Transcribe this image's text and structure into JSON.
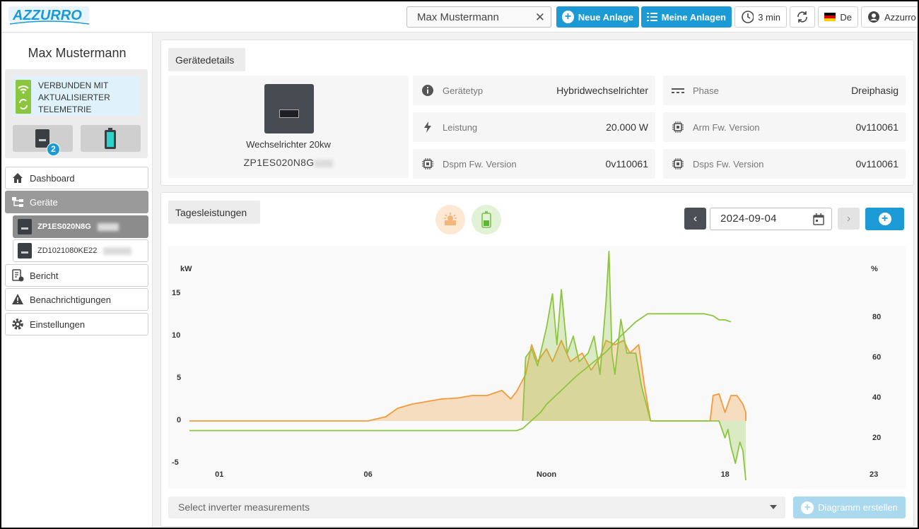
{
  "header": {
    "logo_text": "AZZURRO",
    "search_value": "Max Mustermann",
    "new_plant_label": "Neue Anlage",
    "my_plants_label": "Meine Anlagen",
    "refresh_interval": "3 min",
    "language": "De",
    "account": "Azzurro"
  },
  "sidebar": {
    "user_name": "Max Mustermann",
    "connection_status": "VERBUNDEN MIT AKTUALISIERTER TELEMETRIE",
    "device_count": "2",
    "nav": {
      "dashboard": "Dashboard",
      "devices": "Geräte",
      "device1": "ZP1ES020N8G",
      "device2": "ZD1021080KE22",
      "report": "Bericht",
      "notifications": "Benachrichtigungen",
      "settings": "Einstellungen"
    }
  },
  "device_details": {
    "title": "Gerätedetails",
    "device_name": "Wechselrichter 20kw",
    "serial": "ZP1ES020N8G",
    "specs": [
      {
        "label": "Gerätetyp",
        "value": "Hybridwechselrichter",
        "icon": "info-icon"
      },
      {
        "label": "Phase",
        "value": "Dreiphasig",
        "icon": "phase-icon"
      },
      {
        "label": "Leistung",
        "value": "20.000 W",
        "icon": "bolt-icon"
      },
      {
        "label": "Arm Fw. Version",
        "value": "0v110061",
        "icon": "chip-icon"
      },
      {
        "label": "Dspm Fw. Version",
        "value": "0v110061",
        "icon": "chip-icon"
      },
      {
        "label": "Dsps Fw. Version",
        "value": "0v110061",
        "icon": "chip-icon"
      }
    ]
  },
  "daily": {
    "title": "Tagesleistungen",
    "date": "2024-09-04",
    "select_placeholder": "Select inverter measurements",
    "create_label": "Diagramm erstellen"
  },
  "colors": {
    "accent": "#1b9ad6",
    "pv": "#f39a3c",
    "battery": "#8cc63f"
  },
  "chart_data": {
    "type": "area",
    "y_left_unit": "kW",
    "y_right_unit": "%",
    "y_left_ticks": [
      "15",
      "10",
      "5",
      "0",
      "-5"
    ],
    "y_right_ticks": [
      "80",
      "60",
      "40",
      "20"
    ],
    "x_ticks": [
      "01",
      "06",
      "Noon",
      "18",
      "23"
    ],
    "ylim_left": [
      -7,
      19
    ],
    "ylim_right": [
      20,
      80
    ],
    "series": [
      {
        "color": "#f39a3c",
        "axis": "left",
        "points": [
          [
            0,
            0
          ],
          [
            6,
            0
          ],
          [
            6.6,
            0.5
          ],
          [
            7,
            1.5
          ],
          [
            7.5,
            2
          ],
          [
            8,
            2.3
          ],
          [
            8.5,
            2.6
          ],
          [
            9,
            2.7
          ],
          [
            9.5,
            3
          ],
          [
            10,
            3
          ],
          [
            10.5,
            3.6
          ],
          [
            10.8,
            2.6
          ],
          [
            11,
            3.5
          ],
          [
            11.3,
            5.5
          ],
          [
            11.5,
            9
          ],
          [
            11.7,
            7
          ],
          [
            12,
            8.5
          ],
          [
            12.2,
            7
          ],
          [
            12.5,
            9.5
          ],
          [
            12.8,
            7
          ],
          [
            13.2,
            8
          ],
          [
            13.5,
            6
          ],
          [
            13.8,
            7.5
          ],
          [
            14,
            9.5
          ],
          [
            14.3,
            9
          ],
          [
            14.6,
            9.5
          ],
          [
            14.8,
            8
          ],
          [
            15.1,
            9
          ],
          [
            15.3,
            4
          ],
          [
            15.5,
            0
          ],
          [
            17.5,
            0
          ],
          [
            17.6,
            3
          ],
          [
            17.8,
            3.2
          ],
          [
            18,
            1
          ],
          [
            18.2,
            3
          ],
          [
            18.4,
            3
          ],
          [
            18.6,
            2
          ],
          [
            18.7,
            1
          ],
          [
            18.7,
            0
          ]
        ]
      },
      {
        "color": "#8cc63f",
        "axis": "left",
        "points": [
          [
            11.2,
            0
          ],
          [
            11.3,
            7.5
          ],
          [
            11.5,
            8.5
          ],
          [
            11.7,
            6.5
          ],
          [
            12,
            11
          ],
          [
            12.2,
            15
          ],
          [
            12.35,
            9
          ],
          [
            12.5,
            15.5
          ],
          [
            12.7,
            8
          ],
          [
            12.9,
            10
          ],
          [
            13.1,
            7
          ],
          [
            13.4,
            8
          ],
          [
            13.6,
            10
          ],
          [
            13.8,
            5.5
          ],
          [
            14,
            14
          ],
          [
            14.1,
            20
          ],
          [
            14.2,
            8
          ],
          [
            14.3,
            5.5
          ],
          [
            14.5,
            12
          ],
          [
            14.7,
            8
          ],
          [
            15,
            8
          ],
          [
            15.2,
            4
          ],
          [
            15.5,
            0
          ],
          [
            17.8,
            0
          ],
          [
            18,
            -2
          ],
          [
            18.1,
            -1
          ],
          [
            18.2,
            -3
          ],
          [
            18.35,
            -5
          ],
          [
            18.5,
            -2.5
          ],
          [
            18.6,
            -3.5
          ],
          [
            18.7,
            -7
          ]
        ]
      },
      {
        "color": "#8cc63f",
        "axis": "right",
        "name_hint": "battery SOC",
        "points": [
          [
            0,
            24
          ],
          [
            11,
            24
          ],
          [
            11.2,
            25
          ],
          [
            11.5,
            29
          ],
          [
            11.8,
            33
          ],
          [
            12,
            37
          ],
          [
            12.5,
            44
          ],
          [
            13,
            51
          ],
          [
            13.5,
            57
          ],
          [
            14,
            63
          ],
          [
            14.5,
            71
          ],
          [
            15,
            78
          ],
          [
            15.4,
            82
          ],
          [
            16,
            82
          ],
          [
            17.3,
            82
          ],
          [
            17.6,
            81
          ],
          [
            17.8,
            79
          ],
          [
            18,
            79
          ],
          [
            18.2,
            78
          ]
        ]
      }
    ]
  }
}
